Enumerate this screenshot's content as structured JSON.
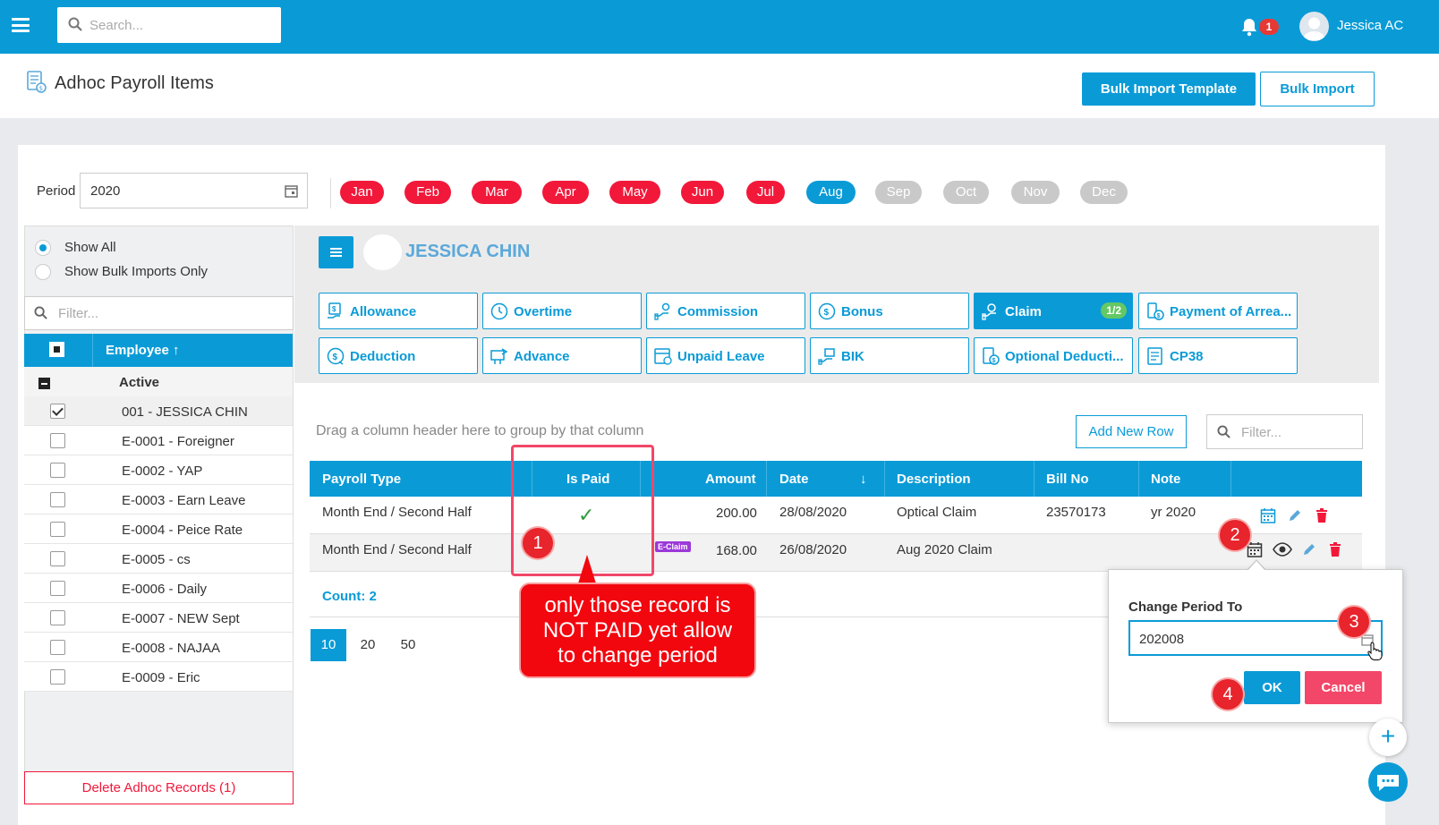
{
  "topbar": {
    "search_placeholder": "Search...",
    "notification_count": "1",
    "user_name": "Jessica AC"
  },
  "header": {
    "title": "Adhoc Payroll Items",
    "bulk_template_label": "Bulk Import Template",
    "bulk_import_label": "Bulk Import"
  },
  "period": {
    "label": "Period",
    "value": "2020",
    "months": [
      {
        "label": "Jan",
        "status": "red"
      },
      {
        "label": "Feb",
        "status": "red"
      },
      {
        "label": "Mar",
        "status": "red"
      },
      {
        "label": "Apr",
        "status": "red"
      },
      {
        "label": "May",
        "status": "red"
      },
      {
        "label": "Jun",
        "status": "red"
      },
      {
        "label": "Jul",
        "status": "red"
      },
      {
        "label": "Aug",
        "status": "blue"
      },
      {
        "label": "Sep",
        "status": "grey"
      },
      {
        "label": "Oct",
        "status": "grey"
      },
      {
        "label": "Nov",
        "status": "grey"
      },
      {
        "label": "Dec",
        "status": "grey"
      }
    ]
  },
  "left_panel": {
    "radio_show_all": "Show All",
    "radio_bulk_only": "Show Bulk Imports Only",
    "filter_placeholder": "Filter...",
    "column_header": "Employee ↑",
    "group_label": "Active",
    "employees": [
      {
        "name": "001 - JESSICA CHIN",
        "checked": true
      },
      {
        "name": "E-0001 - Foreigner",
        "checked": false
      },
      {
        "name": "E-0002 - YAP",
        "checked": false
      },
      {
        "name": "E-0003 - Earn Leave",
        "checked": false
      },
      {
        "name": "E-0004 - Peice Rate",
        "checked": false
      },
      {
        "name": "E-0005 - cs",
        "checked": false
      },
      {
        "name": "E-0006 - Daily",
        "checked": false
      },
      {
        "name": "E-0007 - NEW Sept",
        "checked": false
      },
      {
        "name": "E-0008 - NAJAA",
        "checked": false
      },
      {
        "name": "E-0009 - Eric",
        "checked": false
      }
    ],
    "delete_label": "Delete Adhoc Records (1)"
  },
  "employee": {
    "name": "JESSICA CHIN"
  },
  "tabs": {
    "allowance": "Allowance",
    "overtime": "Overtime",
    "commission": "Commission",
    "bonus": "Bonus",
    "claim": "Claim",
    "claim_badge": "1/2",
    "payment_arrears": "Payment of Arrea...",
    "deduction": "Deduction",
    "advance": "Advance",
    "unpaid_leave": "Unpaid Leave",
    "bik": "BIK",
    "optional_deduction": "Optional Deducti...",
    "cp38": "CP38"
  },
  "grid": {
    "group_hint": "Drag a column header here to group by that column",
    "add_row_label": "Add New Row",
    "filter_placeholder": "Filter...",
    "columns": {
      "payroll_type": "Payroll Type",
      "is_paid": "Is Paid",
      "amount": "Amount",
      "date": "Date",
      "date_sort": "↓",
      "description": "Description",
      "bill_no": "Bill No",
      "note": "Note"
    },
    "rows": [
      {
        "payroll_type": "Month End / Second Half",
        "is_paid": "✓",
        "badge": "",
        "amount": "200.00",
        "date": "28/08/2020",
        "description": "Optical Claim",
        "bill_no": "23570173",
        "note": "yr 2020"
      },
      {
        "payroll_type": "Month End / Second Half",
        "is_paid": "",
        "badge": "E-Claim",
        "amount": "168.00",
        "date": "26/08/2020",
        "description": "Aug 2020 Claim",
        "bill_no": "",
        "note": ""
      }
    ],
    "count_label": "Count: 2",
    "page_sizes": [
      "10",
      "20",
      "50"
    ]
  },
  "annotation": {
    "step1": "1",
    "step2": "2",
    "step3": "3",
    "step4": "4",
    "callout_line1": "only those record is",
    "callout_line2": "NOT PAID yet allow",
    "callout_line3": "to change period"
  },
  "popup": {
    "title": "Change Period To",
    "value": "202008",
    "ok_label": "OK",
    "cancel_label": "Cancel"
  },
  "fab": {
    "plus": "+"
  },
  "colors": {
    "primary": "#0a9bd7",
    "danger": "#f2183a",
    "cancel": "#f24768",
    "badge_green": "#64c864",
    "eclaim": "#9b39d9"
  }
}
